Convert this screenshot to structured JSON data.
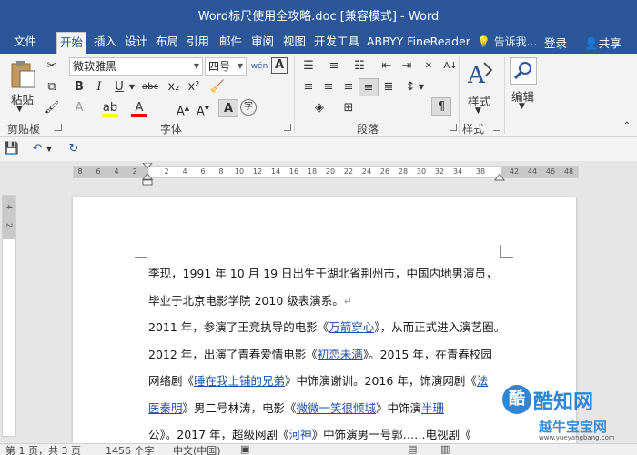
{
  "window": {
    "title": "Word标尺使用全攻略.doc [兼容模式] - Word"
  },
  "tabs": [
    "文件",
    "开始",
    "插入",
    "设计",
    "布局",
    "引用",
    "邮件",
    "审阅",
    "视图",
    "开发工具",
    "ABBYY FineReader"
  ],
  "active_tab": "开始",
  "tell_me": "告诉我...",
  "login": "登录",
  "share": "共享",
  "clipboard": {
    "paste_label": "粘贴",
    "group_label": "剪贴板"
  },
  "font": {
    "name": "微软雅黑",
    "size": "四号",
    "group_label": "字体",
    "bold": "B",
    "italic": "I",
    "underline": "U",
    "strike": "abc",
    "subscript": "x₂",
    "superscript": "x²"
  },
  "paragraph": {
    "group_label": "段落"
  },
  "styles": {
    "label": "样式",
    "group_label": "样式"
  },
  "editing": {
    "label": "编辑"
  },
  "ruler": {
    "horizontal_ticks": [
      "8",
      "6",
      "4",
      "2",
      "2",
      "4",
      "6",
      "8",
      "10",
      "12",
      "14",
      "16",
      "18",
      "20",
      "22",
      "24",
      "26",
      "28",
      "30",
      "32",
      "34",
      "38",
      "42",
      "44",
      "46",
      "48"
    ],
    "vertical_ticks": [
      "4",
      "2"
    ]
  },
  "document": {
    "lines": [
      {
        "parts": [
          {
            "text": "李现，1991 年 10 月 19 日出生于湖北省荆州市，中国内地男演员，"
          }
        ]
      },
      {
        "parts": [
          {
            "text": "毕业于北京电影学院 2010 级表演系。"
          },
          {
            "text": "↵",
            "pilcrow": true
          }
        ]
      },
      {
        "parts": [
          {
            "text": "2011 年，参演了王竞执导的电影《"
          },
          {
            "text": "万箭穿心",
            "link": true
          },
          {
            "text": "》，从而正式进入演艺圈。"
          }
        ]
      },
      {
        "parts": [
          {
            "text": "2012 年，出演了青春爱情电影《"
          },
          {
            "text": "初恋未满",
            "link": true
          },
          {
            "text": "》。2015 年，在青春校园"
          }
        ]
      },
      {
        "parts": [
          {
            "text": "网络剧《"
          },
          {
            "text": "睡在我上铺的兄弟",
            "link": true
          },
          {
            "text": "》中饰演谢训。2016 年，饰演网剧《"
          },
          {
            "text": "法",
            "link": true
          }
        ]
      },
      {
        "parts": [
          {
            "text": "医秦明",
            "link": true
          },
          {
            "text": "》男二号林涛，电影《"
          },
          {
            "text": "微微一笑很倾城",
            "link": true
          },
          {
            "text": "》中饰演"
          },
          {
            "text": "半珊",
            "link": true
          }
        ]
      },
      {
        "parts": [
          {
            "text": "公》。2017 年，超级网剧《"
          },
          {
            "text": "河神",
            "link": true
          },
          {
            "text": "》中饰演男一号郭"
          },
          {
            "text": "……电视剧《"
          }
        ]
      }
    ]
  },
  "watermark": {
    "circle": "酷",
    "brand": "酷知网",
    "brand2": "越牛宝宝网",
    "url": "www.yueyangbang.com"
  },
  "status": {
    "page": "第 1 页，共 3 页",
    "words": "1456 个字",
    "language": "中文(中国)"
  },
  "colors": {
    "accent": "#2b579a",
    "highlight": "#ffff00",
    "font_color": "#ff0000",
    "link": "#1f4fa8"
  }
}
